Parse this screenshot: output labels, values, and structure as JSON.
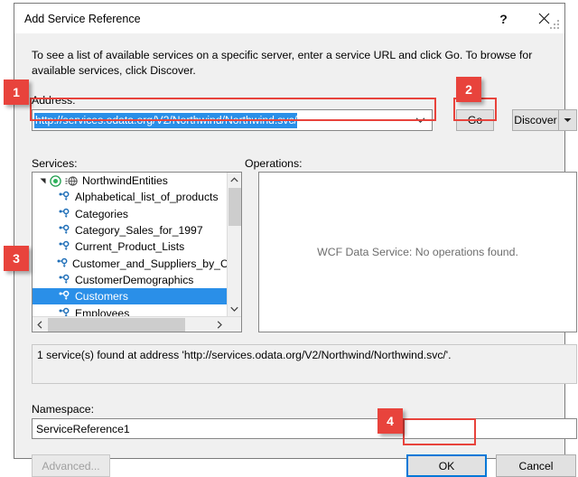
{
  "window": {
    "title": "Add Service Reference",
    "help_label": "?",
    "close_label": "✕"
  },
  "description": "To see a list of available services on a specific server, enter a service URL and click Go. To browse for available services, click Discover.",
  "address": {
    "label": "Address:",
    "value": "http://services.odata.org/V2/Northwind/Northwind.svc/",
    "placeholder": "",
    "dropdown_icon": "chevron-down-icon"
  },
  "buttons": {
    "go": "Go",
    "discover": "Discover",
    "discover_arrow_icon": "caret-down-icon",
    "advanced": "Advanced...",
    "advanced_enabled": false,
    "ok": "OK",
    "cancel": "Cancel"
  },
  "services": {
    "label": "Services:",
    "root": {
      "label": "NorthwindEntities",
      "expander_icon": "expander-expanded-icon",
      "status_icon": "service-node-icon",
      "globe_icon": "globe-icon"
    },
    "items": [
      {
        "label": "Alphabetical_list_of_products",
        "icon": "entity-set-icon",
        "selected": false
      },
      {
        "label": "Categories",
        "icon": "entity-set-icon",
        "selected": false
      },
      {
        "label": "Category_Sales_for_1997",
        "icon": "entity-set-icon",
        "selected": false
      },
      {
        "label": "Current_Product_Lists",
        "icon": "entity-set-icon",
        "selected": false
      },
      {
        "label": "Customer_and_Suppliers_by_City",
        "icon": "entity-set-icon",
        "selected": false
      },
      {
        "label": "CustomerDemographics",
        "icon": "entity-set-icon",
        "selected": false
      },
      {
        "label": "Customers",
        "icon": "entity-set-selected-icon",
        "selected": true
      },
      {
        "label": "Employees",
        "icon": "entity-set-icon",
        "selected": false
      }
    ]
  },
  "operations": {
    "label": "Operations:",
    "empty_message": "WCF Data Service: No operations found."
  },
  "status": {
    "message": "1 service(s) found at address 'http://services.odata.org/V2/Northwind/Northwind.svc/'."
  },
  "namespace": {
    "label": "Namespace:",
    "value": "ServiceReference1"
  },
  "annotations": {
    "badges": [
      {
        "number": "1"
      },
      {
        "number": "2"
      },
      {
        "number": "3"
      },
      {
        "number": "4"
      }
    ],
    "accent_color": "#e8433c",
    "selection_color": "#2a8fe8",
    "focus_color": "#0078d7"
  }
}
